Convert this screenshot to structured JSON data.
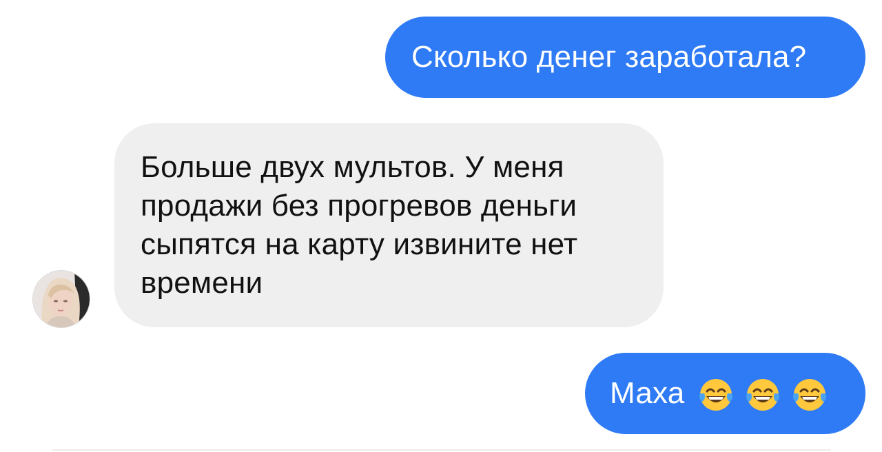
{
  "messages": [
    {
      "direction": "outgoing",
      "text": "Сколько денег заработала?"
    },
    {
      "direction": "incoming",
      "text": "Больше двух мультов. У меня продажи без прогревов деньги сыпятся на карту извините нет времени"
    },
    {
      "direction": "outgoing",
      "text": "Маха",
      "emojis": [
        "face-with-tears-of-joy-emoji",
        "face-with-tears-of-joy-emoji",
        "face-with-tears-of-joy-emoji"
      ]
    }
  ],
  "colors": {
    "outgoing_bubble": "#2f7bf5",
    "incoming_bubble": "#efefef",
    "outgoing_text": "#ffffff",
    "incoming_text": "#111111"
  },
  "avatar": {
    "icon": "user-avatar-photo"
  }
}
